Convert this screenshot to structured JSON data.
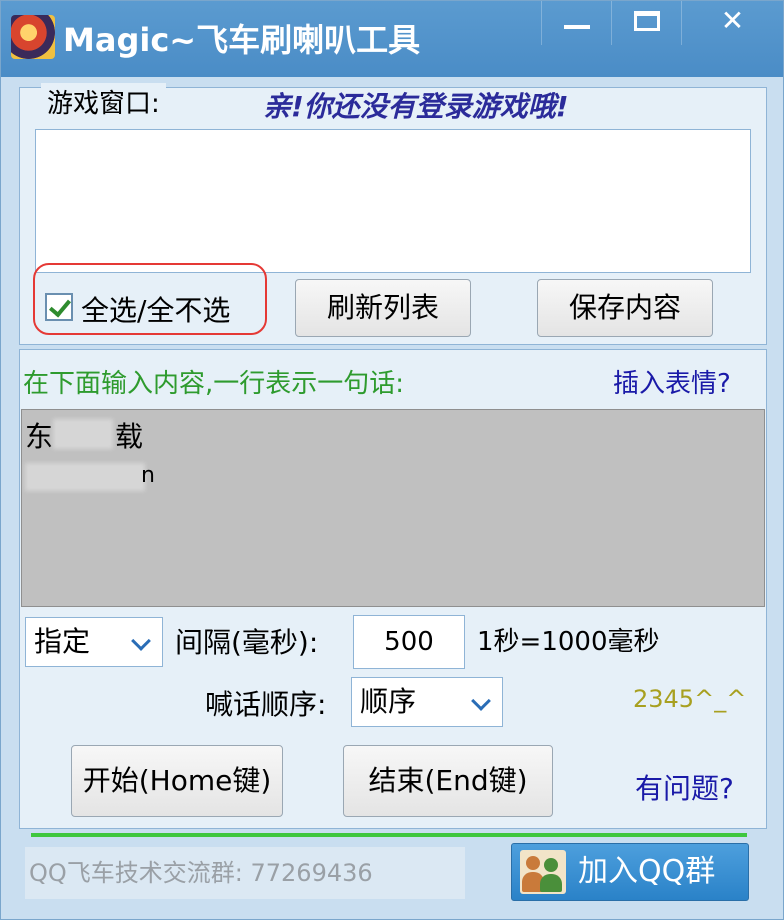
{
  "window": {
    "title": "Magic~飞车刷喇叭工具",
    "icon": "racing-game-icon",
    "controls": {
      "minimize": "minimize-icon",
      "maximize": "maximize-icon",
      "close": "✕"
    }
  },
  "game_window": {
    "group_label": "游戏窗口:",
    "login_status": "亲!你还没有登录游戏哦!",
    "select_all_label": "全选/全不选",
    "select_all_checked": true,
    "refresh_button": "刷新列表",
    "save_button": "保存内容"
  },
  "messages": {
    "hint": "在下面输入内容,一行表示一句话:",
    "insert_emoji": "插入表情?",
    "line1_prefix": "东",
    "line1_suffix": "载",
    "line2_suffix": "n"
  },
  "settings": {
    "mode_selected": "指定",
    "interval_label": "间隔(毫秒):",
    "interval_value": "500",
    "interval_note": "1秒=1000毫秒",
    "order_label": "喊话顺序:",
    "order_selected": "顺序",
    "emoticon": "2345^_^"
  },
  "actions": {
    "start_button": "开始(Home键)",
    "stop_button": "结束(End键)",
    "help_link": "有问题?"
  },
  "progress": {
    "fraction": 1.0
  },
  "footer": {
    "group_info": "QQ飞车技术交流群: 77269436",
    "join_button": "加入QQ群"
  },
  "colors": {
    "titlebar": "#4a8cc6",
    "login_status": "#2b2b9a",
    "hint": "#2e9b2e",
    "link": "#1a1aa8",
    "highlight_ring": "#e53935",
    "progress": "#3ec73e"
  }
}
